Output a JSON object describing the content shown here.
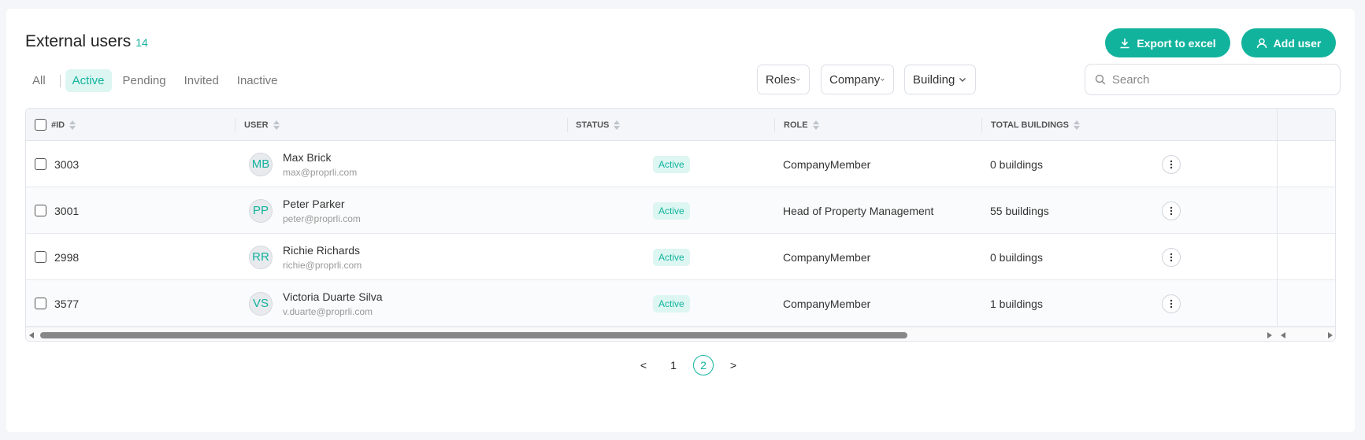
{
  "header": {
    "title": "External users",
    "count": "14"
  },
  "buttons": {
    "export_label": "Export to excel",
    "add_user_label": "Add user"
  },
  "tabs": [
    {
      "label": "All",
      "active": false
    },
    {
      "label": "Active",
      "active": true
    },
    {
      "label": "Pending",
      "active": false
    },
    {
      "label": "Invited",
      "active": false
    },
    {
      "label": "Inactive",
      "active": false
    }
  ],
  "filters": {
    "roles": "Roles",
    "company": "Company",
    "building": "Building"
  },
  "search": {
    "placeholder": "Search",
    "value": ""
  },
  "columns": {
    "id": "#ID",
    "user": "USER",
    "status": "STATUS",
    "role": "ROLE",
    "total_buildings": "TOTAL BUILDINGS"
  },
  "rows": [
    {
      "id": "3003",
      "initials": "MB",
      "name": "Max Brick",
      "email": "max@proprli.com",
      "status": "Active",
      "role": "CompanyMember",
      "buildings": "0 buildings"
    },
    {
      "id": "3001",
      "initials": "PP",
      "name": "Peter Parker",
      "email": "peter@proprli.com",
      "status": "Active",
      "role": "Head of Property Management",
      "buildings": "55 buildings"
    },
    {
      "id": "2998",
      "initials": "RR",
      "name": "Richie Richards",
      "email": "richie@proprli.com",
      "status": "Active",
      "role": "CompanyMember",
      "buildings": "0 buildings"
    },
    {
      "id": "3577",
      "initials": "VS",
      "name": "Victoria Duarte Silva",
      "email": "v.duarte@proprli.com",
      "status": "Active",
      "role": "CompanyMember",
      "buildings": "1 buildings"
    }
  ],
  "pagination": {
    "prev": "<",
    "pages": [
      "1",
      "2"
    ],
    "current": "2",
    "next": ">"
  },
  "colors": {
    "accent": "#12b39d",
    "accent_light": "#ddf6f2"
  },
  "icons": {
    "export": "download-icon",
    "add_user": "user-icon",
    "search": "search-icon",
    "dropdown": "chevron-down-icon",
    "row_menu": "kebab-menu-icon"
  }
}
